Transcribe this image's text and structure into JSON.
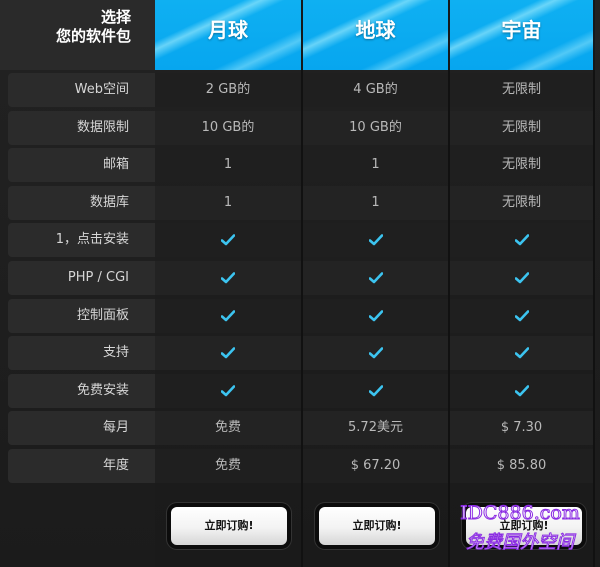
{
  "header": {
    "corner_line1": "选择",
    "corner_line2": "您的软件包",
    "plans": [
      "月球",
      "地球",
      "宇宙"
    ]
  },
  "rows": [
    {
      "label": "Web空间",
      "values": [
        "2 GB的",
        "4 GB的",
        "无限制"
      ]
    },
    {
      "label": "数据限制",
      "values": [
        "10 GB的",
        "10 GB的",
        "无限制"
      ]
    },
    {
      "label": "邮箱",
      "values": [
        "1",
        "1",
        "无限制"
      ]
    },
    {
      "label": "数据库",
      "values": [
        "1",
        "1",
        "无限制"
      ]
    },
    {
      "label": "1，点击安装",
      "values": [
        "✔",
        "✔",
        "✔"
      ]
    },
    {
      "label": "PHP / CGI",
      "values": [
        "✔",
        "✔",
        "✔"
      ]
    },
    {
      "label": "控制面板",
      "values": [
        "✔",
        "✔",
        "✔"
      ]
    },
    {
      "label": "支持",
      "values": [
        "✔",
        "✔",
        "✔"
      ]
    },
    {
      "label": "免费安装",
      "values": [
        "✔",
        "✔",
        "✔"
      ]
    },
    {
      "label": "每月",
      "values": [
        "免费",
        "5.72美元",
        "$ 7.30"
      ]
    },
    {
      "label": "年度",
      "values": [
        "免费",
        "$ 67.20",
        "$ 85.80"
      ]
    }
  ],
  "buttons": {
    "order_label": "立即订购!"
  },
  "watermark": {
    "line1": "IDC886.com",
    "line2": "免费国外空间"
  },
  "colors": {
    "header_blue": "#0aa9f0",
    "check": "#3cc4f0"
  }
}
